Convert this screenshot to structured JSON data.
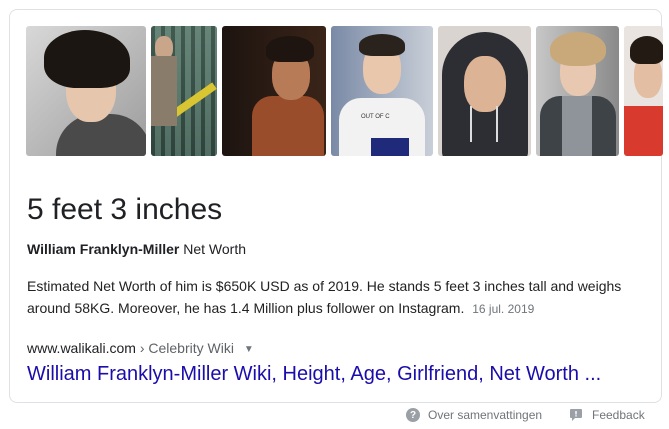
{
  "images": [
    {
      "name": "image-portrait-1"
    },
    {
      "name": "image-portrait-2"
    },
    {
      "name": "image-portrait-3"
    },
    {
      "name": "image-portrait-4",
      "shirt_text": "OUT OF C"
    },
    {
      "name": "image-portrait-5"
    },
    {
      "name": "image-portrait-6"
    },
    {
      "name": "image-portrait-7"
    }
  ],
  "answer": "5 feet 3 inches",
  "subtitle": {
    "name": "William Franklyn-Miller",
    "suffix": "Net Worth"
  },
  "snippet": {
    "text": "Estimated Net Worth of him is $650K USD as of 2019. He stands 5 feet 3 inches tall and weighs around 58KG. Moreover, he has 1.4 Million plus follower on Instagram.",
    "date": "16 jul. 2019"
  },
  "source": {
    "domain": "www.walikali.com",
    "breadcrumb": "› Celebrity Wiki",
    "caret": "▼"
  },
  "result_title": "William Franklyn-Miller Wiki, Height, Age, Girlfriend, Net Worth ...",
  "footer": {
    "about_label": "Over samenvattingen",
    "feedback_label": "Feedback"
  },
  "colors": {
    "link": "#1a0dab",
    "meta": "#70757a",
    "border": "#dfe1e5"
  }
}
